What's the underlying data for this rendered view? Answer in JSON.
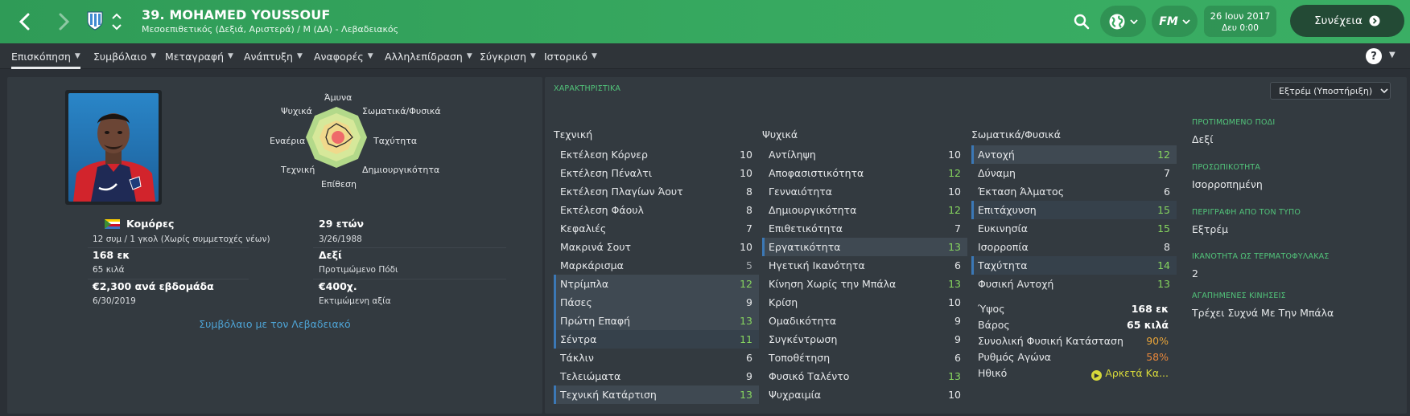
{
  "header": {
    "player_name": "39. MOHAMED YOUSSOUF",
    "player_sub": "Μεσοεπιθετικός (Δεξιά, Αριστερά) / Μ (ΔΑ) - Λεβαδειακός",
    "date": "26 Ιουν 2017",
    "time": "Δευ 0:00",
    "continue_label": "Συνέχεια",
    "fm_label": "FM"
  },
  "nav": {
    "items": [
      "Επισκόπηση",
      "Συμβόλαιο",
      "Μεταγραφή",
      "Ανάπτυξη",
      "Αναφορές",
      "Αλληλεπίδραση",
      "Σύγκριση",
      "Ιστορικό"
    ],
    "help_label": "?"
  },
  "profile": {
    "radar_labels": {
      "top": "Άμυνα",
      "top_right": "Σωματικά/Φυσικά",
      "right": "Ταχύτητα",
      "bottom_right": "Δημιουργικότητα",
      "bottom": "Επίθεση",
      "bottom_left": "Τεχνική",
      "left": "Εναέρια",
      "top_left": "Ψυχικά"
    },
    "nation": "Κομόρες",
    "caps": "12 συμ / 1 γκολ (Χωρίς συμμετοχές νέων)",
    "age": "29 ετών",
    "dob": "3/26/1988",
    "height": "168 εκ",
    "weight": "65 κιλά",
    "foot": "Δεξί",
    "foot_label": "Προτιμώμενο Πόδι",
    "wage": "€2,300 ανά εβδομάδα",
    "contract_end": "6/30/2019",
    "value": "€400χ.",
    "value_label": "Εκτιμώμενη αξία",
    "contract_link": "Συμβόλαιο με τον Λεβαδειακό"
  },
  "attributes": {
    "title": "ΧΑΡΑΚΤΗΡΙΣΤΙΚΑ",
    "role": "Εξτρέμ (Υποστήριξη)",
    "technical_head": "Τεχνική",
    "mental_head": "Ψυχικά",
    "physical_head": "Σωματικά/Φυσικά",
    "technical": [
      {
        "name": "Εκτέλεση Κόρνερ",
        "value": "10"
      },
      {
        "name": "Εκτέλεση Πέναλτι",
        "value": "10"
      },
      {
        "name": "Εκτέλεση Πλαγίων Άουτ",
        "value": "8"
      },
      {
        "name": "Εκτέλεση Φάουλ",
        "value": "8"
      },
      {
        "name": "Κεφαλιές",
        "value": "7"
      },
      {
        "name": "Μακρινά Σουτ",
        "value": "10"
      },
      {
        "name": "Μαρκάρισμα",
        "value": "5"
      },
      {
        "name": "Ντρίμπλα",
        "value": "12"
      },
      {
        "name": "Πάσες",
        "value": "9"
      },
      {
        "name": "Πρώτη Επαφή",
        "value": "13"
      },
      {
        "name": "Σέντρα",
        "value": "11"
      },
      {
        "name": "Τάκλιν",
        "value": "6"
      },
      {
        "name": "Τελειώματα",
        "value": "9"
      },
      {
        "name": "Τεχνική Κατάρτιση",
        "value": "13"
      }
    ],
    "mental": [
      {
        "name": "Αντίληψη",
        "value": "10"
      },
      {
        "name": "Αποφασιστικότητα",
        "value": "12"
      },
      {
        "name": "Γενναιότητα",
        "value": "10"
      },
      {
        "name": "Δημιουργικότητα",
        "value": "12"
      },
      {
        "name": "Επιθετικότητα",
        "value": "7"
      },
      {
        "name": "Εργατικότητα",
        "value": "13"
      },
      {
        "name": "Ηγετική Ικανότητα",
        "value": "6"
      },
      {
        "name": "Κίνηση Χωρίς την Μπάλα",
        "value": "13"
      },
      {
        "name": "Κρίση",
        "value": "10"
      },
      {
        "name": "Ομαδικότητα",
        "value": "9"
      },
      {
        "name": "Συγκέντρωση",
        "value": "9"
      },
      {
        "name": "Τοποθέτηση",
        "value": "6"
      },
      {
        "name": "Φυσικό Ταλέντο",
        "value": "13"
      },
      {
        "name": "Ψυχραιμία",
        "value": "10"
      }
    ],
    "physical": [
      {
        "name": "Αντοχή",
        "value": "12"
      },
      {
        "name": "Δύναμη",
        "value": "7"
      },
      {
        "name": "Έκταση Άλματος",
        "value": "6"
      },
      {
        "name": "Επιτάχυνση",
        "value": "15"
      },
      {
        "name": "Ευκινησία",
        "value": "15"
      },
      {
        "name": "Ισορροπία",
        "value": "8"
      },
      {
        "name": "Ταχύτητα",
        "value": "14"
      },
      {
        "name": "Φυσική Αντοχή",
        "value": "13"
      }
    ],
    "physical_extra": [
      {
        "name": "Ύψος",
        "value": "168 εκ"
      },
      {
        "name": "Βάρος",
        "value": "65 κιλά"
      },
      {
        "name": "Συνολική Φυσική Κατάσταση",
        "value": "90%"
      },
      {
        "name": "Ρυθμός Αγώνα",
        "value": "58%"
      },
      {
        "name": "Ηθικό",
        "value": "Αρκετά Κα..."
      }
    ],
    "side": [
      {
        "title": "ΠΡΟΤΙΜΩΜΕΝΟ ΠΟΔΙ",
        "value": "Δεξί"
      },
      {
        "title": "ΠΡΟΣΩΠΙΚΟΤΗΤΑ",
        "value": "Ισορροπημένη"
      },
      {
        "title": "ΠΕΡΙΓΡΑΦΗ ΑΠΟ ΤΟΝ ΤΥΠΟ",
        "value": "Εξτρέμ"
      },
      {
        "title": "ΙΚΑΝΟΤΗΤΑ ΩΣ ΤΕΡΜΑΤΟΦΥΛΑΚΑΣ",
        "value": "2"
      },
      {
        "title": "ΑΓΑΠΗΜΕΝΕΣ ΚΙΝΗΣΕΙΣ",
        "value": "Τρέχει Συχνά Με Την Μπάλα"
      }
    ]
  },
  "colors": {
    "header_green": "#37a960",
    "accent_green": "#52c47a",
    "link_blue": "#4ea4d6",
    "highlight_blue": "#3b78b6",
    "value_green": "#86d55f",
    "value_orange": "#e8873a",
    "morale_yellow": "#d6d83a"
  }
}
